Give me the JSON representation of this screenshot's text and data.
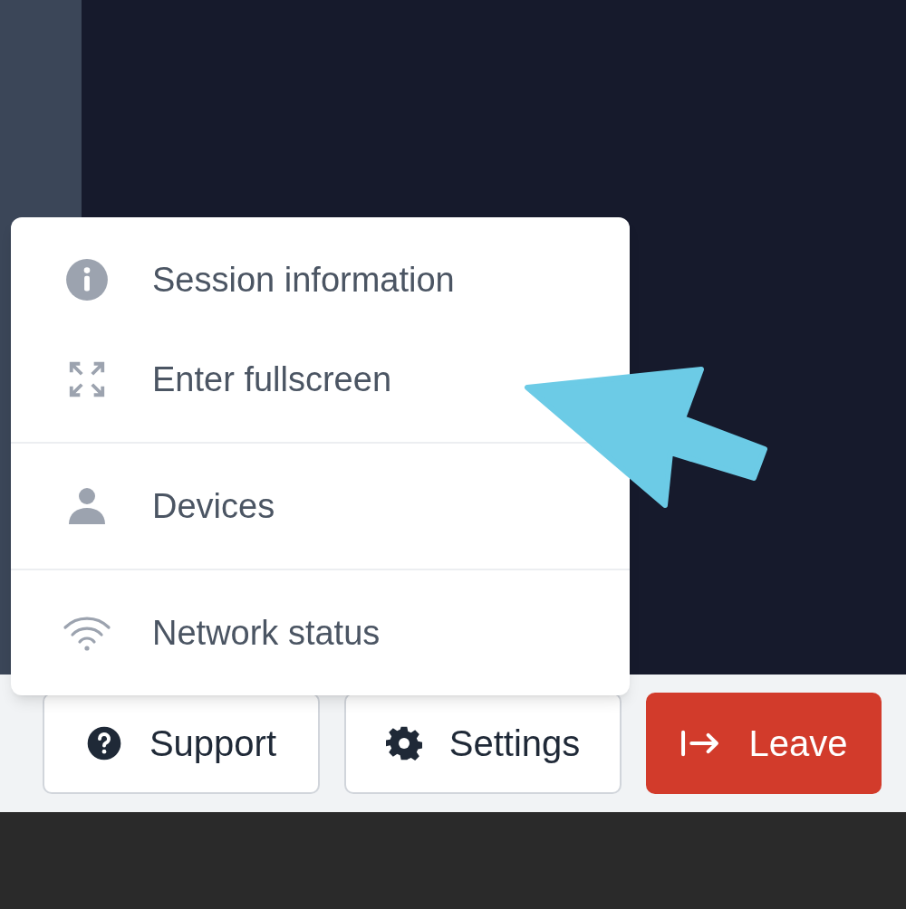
{
  "menu": {
    "groups": [
      {
        "items": [
          {
            "label": "Session information"
          },
          {
            "label": "Enter fullscreen"
          }
        ]
      },
      {
        "items": [
          {
            "label": "Devices"
          }
        ]
      },
      {
        "items": [
          {
            "label": "Network status"
          }
        ]
      }
    ]
  },
  "toolbar": {
    "buttons": [
      {
        "label": "Support",
        "kind": "default"
      },
      {
        "label": "Settings",
        "kind": "default"
      },
      {
        "label": "Leave",
        "kind": "danger"
      }
    ]
  }
}
